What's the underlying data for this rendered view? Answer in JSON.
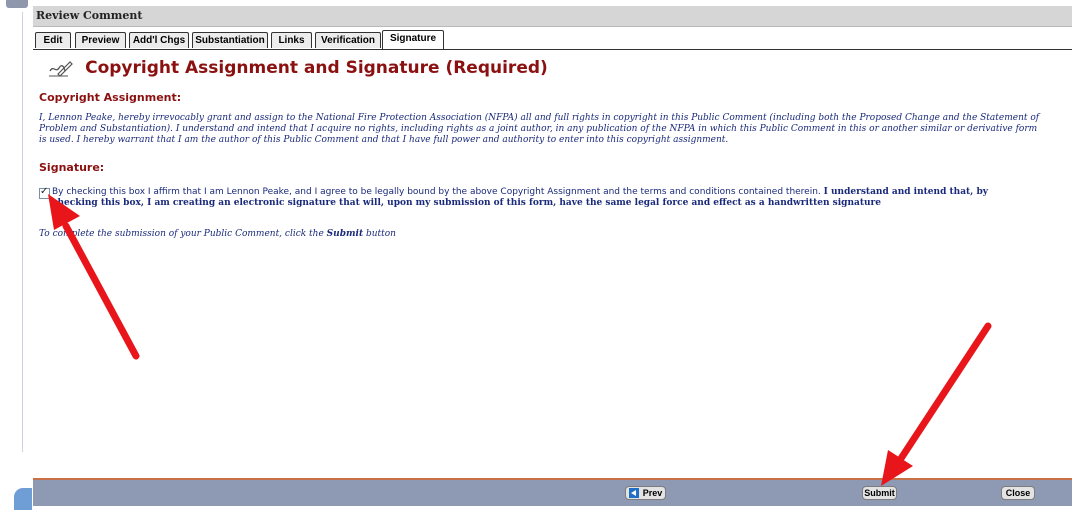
{
  "window": {
    "title": "Review Comment"
  },
  "tabs": [
    {
      "label": "Edit",
      "active": false
    },
    {
      "label": "Preview",
      "active": false
    },
    {
      "label": "Add'l Chgs",
      "active": false
    },
    {
      "label": "Substantiation",
      "active": false
    },
    {
      "label": "Links",
      "active": false
    },
    {
      "label": "Verification",
      "active": false
    },
    {
      "label": "Signature",
      "active": true
    }
  ],
  "page": {
    "heading": "Copyright Assignment and Signature (Required)",
    "copyright_label": "Copyright Assignment:",
    "copyright_text": [
      "I, Lennon Peake, hereby irrevocably grant and assign to the National Fire Protection Association (NFPA) all and full rights in copyright in this Public Comment (including both the Proposed Change and the Statement of",
      "Problem and Substantiation). I understand and intend that I acquire no rights, including rights as a joint author, in any publication of the NFPA in which this Public Comment in this or another similar or derivative form",
      "is used. I hereby warrant that I am the author of this Public Comment and that I have full power and authority to enter into this copyright assignment."
    ],
    "signature_label": "Signature:",
    "signature_checked": true,
    "signature_text": {
      "normal": "By checking this box I affirm that I am Lennon Peake, and I agree to be legally bound by the above Copyright Assignment and the terms and conditions contained therein. ",
      "bold_1": "I understand and intend that, by",
      "bold_2": "checking this box, I am creating an electronic signature that will, upon my submission of this form, have the same legal force and effect as a handwritten signature"
    },
    "complete_prefix": "To complete the submission of your Public Comment, click the ",
    "complete_bold": "Submit",
    "complete_suffix": " button"
  },
  "footer": {
    "prev_label": "Prev",
    "submit_label": "Submit",
    "close_label": "Close"
  },
  "colors": {
    "accent_red": "#8b1111",
    "text_blue": "#1a2a7a",
    "footer_bg": "#8e99b3",
    "annotation": "#e8161b"
  }
}
